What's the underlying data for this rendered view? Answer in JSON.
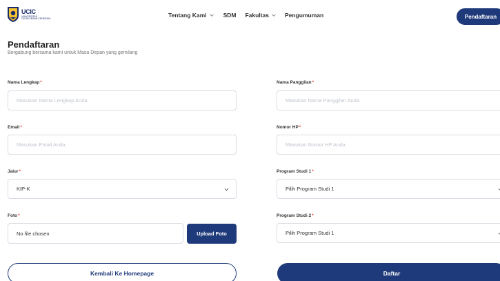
{
  "brand": {
    "logo_text": "UCIC",
    "logo_sub1": "UNIVERSITAS",
    "logo_sub2": "CATUR INSAN CENDEKIA",
    "primary_color": "#1f3a7a"
  },
  "nav": {
    "items": [
      {
        "label": "Tentang Kami",
        "has_dropdown": true
      },
      {
        "label": "SDM",
        "has_dropdown": false
      },
      {
        "label": "Fakultas",
        "has_dropdown": true
      },
      {
        "label": "Pengumuman",
        "has_dropdown": false
      }
    ],
    "cta_label": "Pendaftaran"
  },
  "page": {
    "title": "Pendaftaran",
    "subtitle": "Bergabung bersama kami untuk Masa Depan yang gemilang"
  },
  "form": {
    "required_mark": "*",
    "nama_lengkap": {
      "label": "Nama Lengkap",
      "placeholder": "Masukan Nama Lengkap Anda"
    },
    "nama_panggilan": {
      "label": "Nama Panggilan",
      "placeholder": "Masukan Nama Panggilan Anda"
    },
    "email": {
      "label": "Email",
      "placeholder": "Masukan Email Anda"
    },
    "nomor_hp": {
      "label": "Nomor HP",
      "placeholder": "Masukan Nomor HP Anda"
    },
    "jalur": {
      "label": "Jalur",
      "value": "KIP-K"
    },
    "prodi1": {
      "label": "Program Studi 1",
      "value": "Pilih Program Studi 1"
    },
    "foto": {
      "label": "Foto",
      "file_status": "No file chosen",
      "upload_label": "Upload Foto"
    },
    "prodi2": {
      "label": "Program Studi 2",
      "value": "Pilih Program Studi 1"
    },
    "back_label": "Kembali Ke Homepage",
    "submit_label": "Daftar"
  }
}
